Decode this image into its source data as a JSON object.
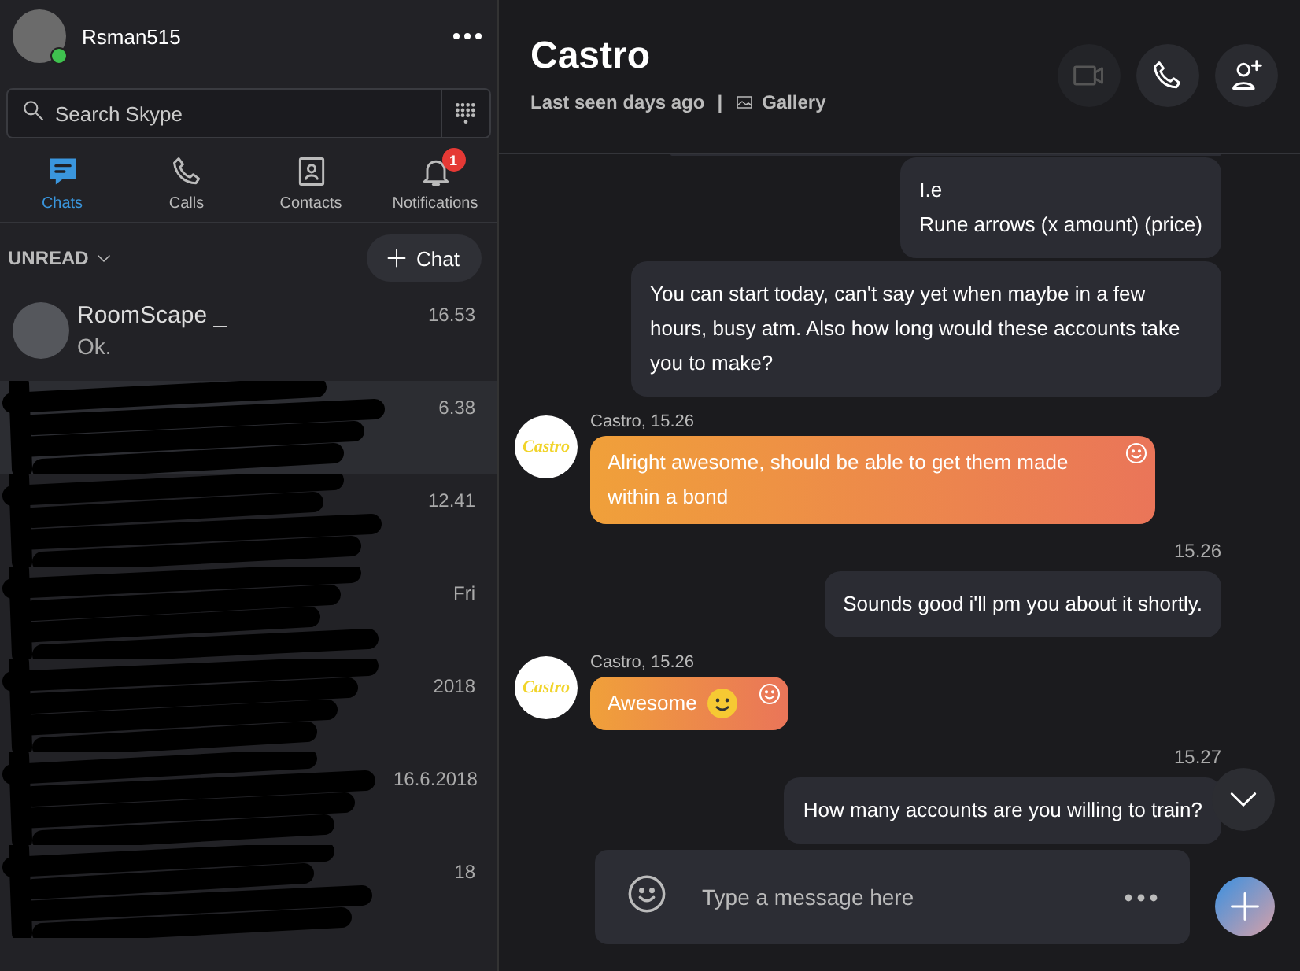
{
  "profile": {
    "name": "Rsman515",
    "online": true
  },
  "search": {
    "placeholder": "Search Skype"
  },
  "nav": [
    {
      "label": "Chats",
      "selected": true
    },
    {
      "label": "Calls",
      "selected": false
    },
    {
      "label": "Contacts",
      "selected": false
    },
    {
      "label": "Notifications",
      "selected": false,
      "badge": "1"
    }
  ],
  "filter": {
    "label": "UNREAD"
  },
  "new_chat_button": "Chat",
  "chats": [
    {
      "name": "RoomScape _",
      "preview": "Ok.",
      "time": "16.53",
      "selected": false
    },
    {
      "time": "6.38",
      "selected": true
    },
    {
      "time": "12.41",
      "selected": false
    },
    {
      "time": "Fri",
      "selected": false
    },
    {
      "time": "2018",
      "selected": false
    },
    {
      "time": "16.6.2018",
      "selected": false
    },
    {
      "time": "18",
      "selected": false
    }
  ],
  "conversation": {
    "title": "Castro",
    "status": "Last seen days ago",
    "separator": "|",
    "gallery": "Gallery",
    "actions": [
      {
        "disabled": true
      },
      {
        "disabled": false
      },
      {
        "disabled": false
      }
    ]
  },
  "messages": [
    {
      "kind": "fragment"
    },
    {
      "kind": "out",
      "lines": [
        "I.e",
        "Rune arrows (x amount) (price)"
      ]
    },
    {
      "kind": "out",
      "lines": [
        "You can start today, can't say yet when maybe in a few hours, busy atm. Also how long would these accounts take you to make?"
      ]
    },
    {
      "kind": "in",
      "avatar_text": "Castro",
      "sender": "Castro, 15.26",
      "lines": [
        "Alright awesome, should be able to get them made within a bond"
      ],
      "emoji": false
    },
    {
      "kind": "time",
      "text": "15.26"
    },
    {
      "kind": "out",
      "lines": [
        "Sounds good i'll pm you about it shortly."
      ]
    },
    {
      "kind": "in",
      "avatar_text": "Castro",
      "sender": "Castro, 15.26",
      "lines": [
        "Awesome"
      ],
      "emoji": true
    },
    {
      "kind": "time",
      "text": "15.27"
    },
    {
      "kind": "out",
      "lines": [
        "How many accounts are you willing to train?"
      ]
    }
  ],
  "composer": {
    "placeholder": "Type a message here"
  }
}
